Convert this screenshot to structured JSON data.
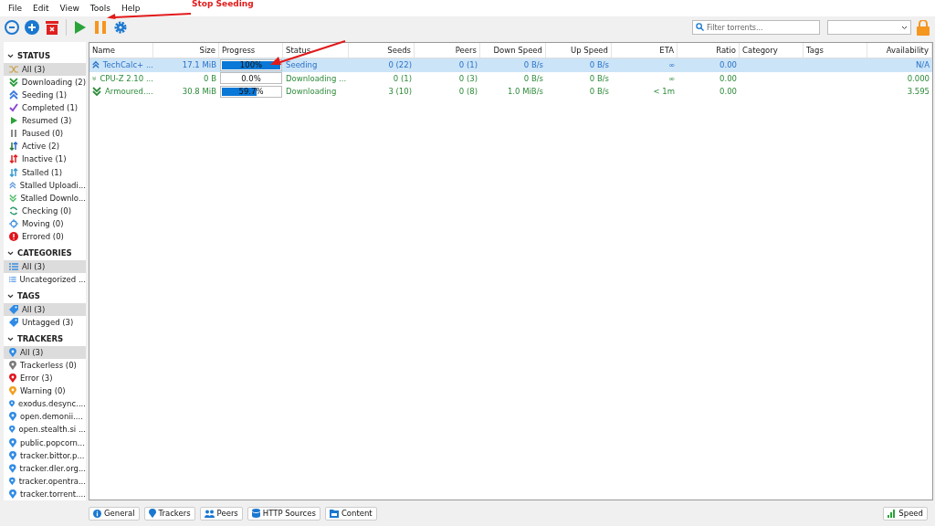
{
  "menu": [
    "File",
    "Edit",
    "View",
    "Tools",
    "Help"
  ],
  "annotation": {
    "label": "Stop Seeding"
  },
  "search": {
    "placeholder": "Filter torrents..."
  },
  "sidebar": [
    {
      "title": "STATUS",
      "expanded": true,
      "items": [
        {
          "label": "All (3)",
          "selected": true
        },
        {
          "label": "Downloading (2)",
          "selected": false
        },
        {
          "label": "Seeding (1)",
          "selected": false
        },
        {
          "label": "Completed (1)",
          "selected": false
        },
        {
          "label": "Resumed (3)",
          "selected": false
        },
        {
          "label": "Paused (0)",
          "selected": false
        },
        {
          "label": "Active (2)",
          "selected": false
        },
        {
          "label": "Inactive (1)",
          "selected": false
        },
        {
          "label": "Stalled (1)",
          "selected": false
        },
        {
          "label": "Stalled Uploadi...",
          "selected": false
        },
        {
          "label": "Stalled Downlo...",
          "selected": false
        },
        {
          "label": "Checking (0)",
          "selected": false
        },
        {
          "label": "Moving (0)",
          "selected": false
        },
        {
          "label": "Errored (0)",
          "selected": false
        }
      ]
    },
    {
      "title": "CATEGORIES",
      "expanded": true,
      "items": [
        {
          "label": "All (3)",
          "selected": true
        },
        {
          "label": "Uncategorized ...",
          "selected": false
        }
      ]
    },
    {
      "title": "TAGS",
      "expanded": true,
      "items": [
        {
          "label": "All (3)",
          "selected": true
        },
        {
          "label": "Untagged (3)",
          "selected": false
        }
      ]
    },
    {
      "title": "TRACKERS",
      "expanded": true,
      "items": [
        {
          "label": "All (3)",
          "selected": true,
          "color": "#2f8be6"
        },
        {
          "label": "Trackerless (0)",
          "selected": false,
          "color": "#7a7a7a"
        },
        {
          "label": "Error (3)",
          "selected": false,
          "color": "#e0141e"
        },
        {
          "label": "Warning (0)",
          "selected": false,
          "color": "#f0a020"
        },
        {
          "label": "exodus.desync....",
          "selected": false,
          "color": "#2f8be6"
        },
        {
          "label": "open.demonii....",
          "selected": false,
          "color": "#2f8be6"
        },
        {
          "label": "open.stealth.si ...",
          "selected": false,
          "color": "#2f8be6"
        },
        {
          "label": "public.popcorn...",
          "selected": false,
          "color": "#2f8be6"
        },
        {
          "label": "tracker.bittor.p...",
          "selected": false,
          "color": "#2f8be6"
        },
        {
          "label": "tracker.dler.org...",
          "selected": false,
          "color": "#2f8be6"
        },
        {
          "label": "tracker.opentra...",
          "selected": false,
          "color": "#2f8be6"
        },
        {
          "label": "tracker.torrent....",
          "selected": false,
          "color": "#2f8be6"
        }
      ]
    }
  ],
  "table": {
    "columns": [
      "Name",
      "Size",
      "Progress",
      "Status",
      "Seeds",
      "Peers",
      "Down Speed",
      "Up Speed",
      "ETA",
      "Ratio",
      "Category",
      "Tags",
      "Availability"
    ],
    "rows": [
      {
        "kind": "seeding",
        "selected": true,
        "name": "TechCalc+ ...",
        "size": "17.1 MiB",
        "level": 1,
        "progress": "100%",
        "status": "Seeding",
        "seeds": "0 (22)",
        "peers": "0 (1)",
        "down": "0 B/s",
        "up": "0 B/s",
        "eta": "∞",
        "ratio": "0.00",
        "availability": "N/A"
      },
      {
        "kind": "downloading",
        "selected": false,
        "name": "CPU-Z 2.10 ...",
        "size": "0 B",
        "level": 0,
        "progress": "0.0%",
        "status": "Downloading ...",
        "seeds": "0 (1)",
        "peers": "0 (3)",
        "down": "0 B/s",
        "up": "0 B/s",
        "eta": "∞",
        "ratio": "0.00",
        "availability": "0.000"
      },
      {
        "kind": "downloading",
        "selected": false,
        "name": "Armoured....",
        "size": "30.8 MiB",
        "level": 0.597,
        "progress": "59.7%",
        "status": "Downloading",
        "seeds": "3 (10)",
        "peers": "0 (8)",
        "down": "1.0 MiB/s",
        "up": "0 B/s",
        "eta": "< 1m",
        "ratio": "0.00",
        "availability": "3.595"
      }
    ]
  },
  "bottom_tabs": [
    "General",
    "Trackers",
    "Peers",
    "HTTP Sources",
    "Content"
  ],
  "speed_button": "Speed"
}
